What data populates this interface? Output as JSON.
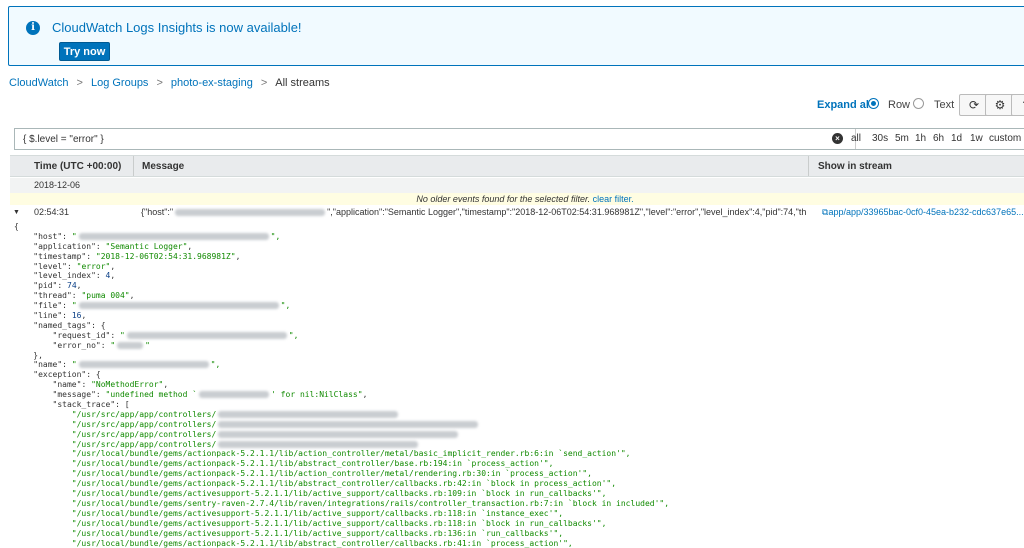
{
  "banner": {
    "title": "CloudWatch Logs Insights is now available!",
    "button_label": "Try now",
    "icon": "info-icon"
  },
  "breadcrumb": {
    "items": [
      "CloudWatch",
      "Log Groups",
      "photo-ex-staging"
    ],
    "current": "All streams",
    "separator": ">"
  },
  "controls": {
    "expand_all": "Expand all",
    "view_row": "Row",
    "view_text": "Text",
    "selected_view": "Row",
    "tool_icons": [
      "refresh-icon",
      "settings-icon",
      "help-icon"
    ]
  },
  "filter": {
    "value": "{ $.level = \"error\" }",
    "ranges": [
      "all",
      "30s",
      "5m",
      "1h",
      "6h",
      "1d",
      "1w",
      "custom"
    ]
  },
  "table": {
    "headers": {
      "time": "Time (UTC +00:00)",
      "message": "Message",
      "stream": "Show in stream"
    },
    "date": "2018-12-06",
    "notice": "No older events found for the selected filter.",
    "clear_filter": "clear filter.",
    "event": {
      "time": "02:54:31",
      "msg_prefix": "{\"host\":\"",
      "msg_suffix": "\",\"application\":\"Semantic Logger\",\"timestamp\":\"2018-12-06T02:54:31.968981Z\",\"level\":\"error\",\"level_index\":4,\"pid\":74,\"th",
      "stream": "app/app/33965bac-0cf0-45ea-b232-cdc637e65..."
    }
  },
  "json": {
    "open": "{",
    "host_key": "\"host\"",
    "application_key": "\"application\"",
    "application": "\"Semantic Logger\"",
    "timestamp_key": "\"timestamp\"",
    "timestamp": "\"2018-12-06T02:54:31.968981Z\"",
    "level_key": "\"level\"",
    "level": "\"error\"",
    "level_index_key": "\"level_index\"",
    "level_index": "4",
    "pid_key": "\"pid\"",
    "pid": "74",
    "thread_key": "\"thread\"",
    "thread": "\"puma 004\"",
    "file_key": "\"file\"",
    "line_key": "\"line\"",
    "line": "16",
    "named_tags_key": "\"named_tags\"",
    "request_id_key": "\"request_id\"",
    "error_no_key": "\"error_no\"",
    "close_obj": "},",
    "name_key": "\"name\"",
    "exception_key": "\"exception\"",
    "exc_name_key": "\"name\"",
    "exc_name": "\"NoMethodError\"",
    "message_key": "\"message\"",
    "message_start": "\"undefined method `",
    "message_end": "' for nil:NilClass\"",
    "stack_trace_key": "\"stack_trace\"",
    "controllers_prefix": "\"/usr/src/app/app/controllers/",
    "trace": [
      "\"/usr/local/bundle/gems/actionpack-5.2.1.1/lib/action_controller/metal/basic_implicit_render.rb:6:in `send_action'\",",
      "\"/usr/local/bundle/gems/actionpack-5.2.1.1/lib/abstract_controller/base.rb:194:in `process_action'\",",
      "\"/usr/local/bundle/gems/actionpack-5.2.1.1/lib/action_controller/metal/rendering.rb:30:in `process_action'\",",
      "\"/usr/local/bundle/gems/actionpack-5.2.1.1/lib/abstract_controller/callbacks.rb:42:in `block in process_action'\",",
      "\"/usr/local/bundle/gems/activesupport-5.2.1.1/lib/active_support/callbacks.rb:109:in `block in run_callbacks'\",",
      "\"/usr/local/bundle/gems/sentry-raven-2.7.4/lib/raven/integrations/rails/controller_transaction.rb:7:in `block in included'\",",
      "\"/usr/local/bundle/gems/activesupport-5.2.1.1/lib/active_support/callbacks.rb:118:in `instance_exec'\",",
      "\"/usr/local/bundle/gems/activesupport-5.2.1.1/lib/active_support/callbacks.rb:118:in `block in run_callbacks'\",",
      "\"/usr/local/bundle/gems/activesupport-5.2.1.1/lib/active_support/callbacks.rb:136:in `run_callbacks'\",",
      "\"/usr/local/bundle/gems/actionpack-5.2.1.1/lib/abstract_controller/callbacks.rb:41:in `process_action'\","
    ]
  },
  "colors": {
    "accent": "#0073bb",
    "json_string": "#108a00",
    "json_number": "#0a3f86",
    "notice_bg": "#fffde2"
  }
}
